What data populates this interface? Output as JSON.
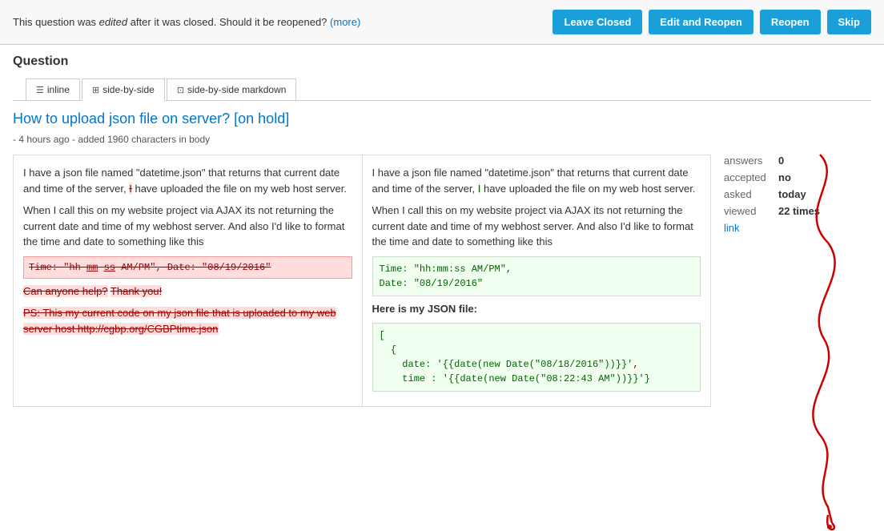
{
  "banner": {
    "text_before_italic": "This question was ",
    "italic_text": "edited",
    "text_after_italic": " after it was closed. Should it be reopened?",
    "more_link": "(more)",
    "buttons": [
      {
        "label": "Leave Closed",
        "name": "leave-closed"
      },
      {
        "label": "Edit and Reopen",
        "name": "edit-reopen"
      },
      {
        "label": "Reopen",
        "name": "reopen"
      },
      {
        "label": "Skip",
        "name": "skip"
      }
    ]
  },
  "tabs": [
    {
      "label": "inline",
      "icon": "☰",
      "active": false
    },
    {
      "label": "side-by-side",
      "icon": "⊞",
      "active": true
    },
    {
      "label": "side-by-side markdown",
      "icon": "⊡",
      "active": false
    }
  ],
  "question": {
    "section_label": "Question",
    "title": "How to upload json file on server? [on hold]",
    "edit_info": "- 4 hours ago - added 1960 characters in body"
  },
  "diff_left": {
    "para1": "I have a json file named \"datetime.json\" that returns that current date and time of the server, I have uploaded the file on my web host server.",
    "para2": "When I call this on my website project via AJAX its not returning the current date and time of my webhost server. And also I'd like to format the time and date to something like this",
    "deleted_code": "Time: \"hh mm ss AM/PM\", Date: \"08/19/2016\"",
    "deleted_text1": "Can anyone help?",
    "deleted_text2": "Thank you!",
    "deleted_ps": "PS: This my current code on my json file that is uploaded to my web server host http://cgbp.org/CGBPtime.json"
  },
  "diff_right": {
    "para1": "I have a json file named \"datetime.json\" that returns that current date and time of the server, I have uploaded the file on my web host server.",
    "para2": "When I call this on my website project via AJAX its not returning the current date and time of my webhost server. And also I'd like to format the time and date to something like this",
    "code_block": "Time: \"hh:mm:ss AM/PM\",\nDate: \"08/19/2016\"",
    "added_text": "Here is my JSON file:",
    "json_code_line1": "[",
    "json_code_line2": "  {",
    "json_code_line3": "    date: '{{date(new Date(\"08/18/2016\"))}}',",
    "json_code_line4": "    time : '{{date(new Date(\"08:22:43 AM\"))}}'}"
  },
  "sidebar": {
    "answers_label": "answers",
    "answers_value": "0",
    "accepted_label": "accepted",
    "accepted_value": "no",
    "asked_label": "asked",
    "asked_value": "today",
    "viewed_label": "viewed",
    "viewed_value": "22 times",
    "link_text": "link"
  },
  "colors": {
    "blue_btn": "#1a9fd9",
    "link": "#0077cc",
    "deleted_bg": "#fdd",
    "added_bg": "#dfd",
    "code_bg": "#f0fff0"
  }
}
